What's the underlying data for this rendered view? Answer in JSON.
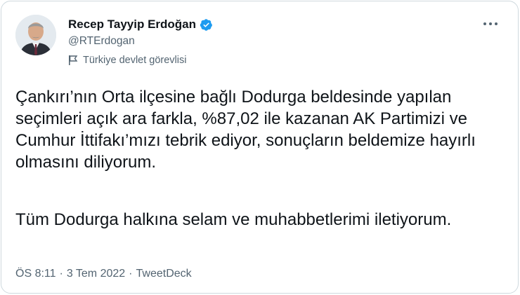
{
  "author": {
    "name": "Recep Tayyip Erdoğan",
    "handle": "@RTErdogan",
    "label": "Türkiye devlet görevlisi",
    "verified_color": "#1d9bf0"
  },
  "tweet": {
    "paragraph1": "Çankırı’nın Orta ilçesine bağlı Dodurga beldesinde yapılan seçimleri açık ara farkla, %87,02 ile kazanan AK Partimizi ve Cumhur İttifakı’mızı tebrik ediyor, sonuçların beldemize hayırlı olmasını diliyorum.",
    "paragraph2": "Tüm Dodurga halkına selam ve muhabbetlerimi iletiyorum."
  },
  "meta": {
    "time": "ÖS 8:11",
    "separator": "·",
    "date": "3 Tem 2022",
    "source": "TweetDeck"
  }
}
